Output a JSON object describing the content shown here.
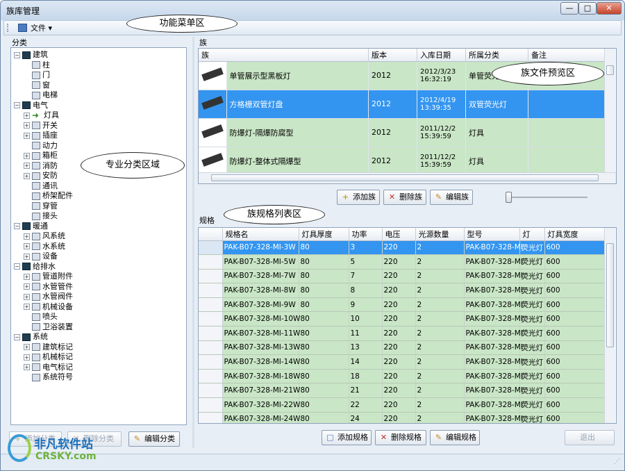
{
  "window": {
    "title": "族库管理",
    "min_icon": "minimize-icon",
    "max_icon": "maximize-icon",
    "close_icon": "close-icon",
    "min_glyph": "—",
    "max_glyph": "□",
    "close_glyph": "✕"
  },
  "menu": {
    "file_label": "文件 ▾"
  },
  "left": {
    "panel_label": "分类"
  },
  "tree": [
    {
      "label": "建筑",
      "level": 0,
      "exp": "−",
      "icon": "dark"
    },
    {
      "label": "柱",
      "level": 1,
      "exp": "",
      "icon": "doc"
    },
    {
      "label": "门",
      "level": 1,
      "exp": "",
      "icon": "doc"
    },
    {
      "label": "窗",
      "level": 1,
      "exp": "",
      "icon": "doc"
    },
    {
      "label": "电梯",
      "level": 1,
      "exp": "",
      "icon": "doc"
    },
    {
      "label": "电气",
      "level": 0,
      "exp": "−",
      "icon": "dark"
    },
    {
      "label": "灯具",
      "level": 1,
      "exp": "+",
      "icon": "arrow"
    },
    {
      "label": "开关",
      "level": 1,
      "exp": "+",
      "icon": "doc"
    },
    {
      "label": "插座",
      "level": 1,
      "exp": "+",
      "icon": "doc"
    },
    {
      "label": "动力",
      "level": 1,
      "exp": "",
      "icon": "doc"
    },
    {
      "label": "箱柜",
      "level": 1,
      "exp": "+",
      "icon": "doc"
    },
    {
      "label": "消防",
      "level": 1,
      "exp": "+",
      "icon": "doc"
    },
    {
      "label": "安防",
      "level": 1,
      "exp": "+",
      "icon": "doc"
    },
    {
      "label": "通讯",
      "level": 1,
      "exp": "",
      "icon": "doc"
    },
    {
      "label": "桥架配件",
      "level": 1,
      "exp": "",
      "icon": "doc"
    },
    {
      "label": "穿管",
      "level": 1,
      "exp": "",
      "icon": "doc"
    },
    {
      "label": "接头",
      "level": 1,
      "exp": "",
      "icon": "doc"
    },
    {
      "label": "暖通",
      "level": 0,
      "exp": "−",
      "icon": "dark"
    },
    {
      "label": "风系统",
      "level": 1,
      "exp": "+",
      "icon": "doc"
    },
    {
      "label": "水系统",
      "level": 1,
      "exp": "+",
      "icon": "doc"
    },
    {
      "label": "设备",
      "level": 1,
      "exp": "+",
      "icon": "doc"
    },
    {
      "label": "给排水",
      "level": 0,
      "exp": "−",
      "icon": "dark"
    },
    {
      "label": "管道附件",
      "level": 1,
      "exp": "+",
      "icon": "doc"
    },
    {
      "label": "水管管件",
      "level": 1,
      "exp": "+",
      "icon": "doc"
    },
    {
      "label": "水管阀件",
      "level": 1,
      "exp": "+",
      "icon": "doc"
    },
    {
      "label": "机械设备",
      "level": 1,
      "exp": "+",
      "icon": "doc"
    },
    {
      "label": "喷头",
      "level": 1,
      "exp": "",
      "icon": "doc"
    },
    {
      "label": "卫浴装置",
      "level": 1,
      "exp": "",
      "icon": "doc"
    },
    {
      "label": "系统",
      "level": 0,
      "exp": "−",
      "icon": "dark"
    },
    {
      "label": "建筑标记",
      "level": 1,
      "exp": "+",
      "icon": "doc"
    },
    {
      "label": "机械标记",
      "level": 1,
      "exp": "+",
      "icon": "doc"
    },
    {
      "label": "电气标记",
      "level": 1,
      "exp": "+",
      "icon": "doc"
    },
    {
      "label": "系统符号",
      "level": 1,
      "exp": "",
      "icon": "doc"
    }
  ],
  "left_buttons": {
    "add": "添加分类",
    "del": "删除分类",
    "edit": "编辑分类"
  },
  "family": {
    "panel_label": "族",
    "headers": [
      "族",
      "版本",
      "入库日期",
      "所属分类",
      "备注"
    ],
    "rows": [
      {
        "name": "单管展示型黑板灯",
        "version": "2012",
        "date": "2012/3/23\n16:32:19",
        "category": "单管荧光灯",
        "note": "",
        "selected": false
      },
      {
        "name": "方格栅双管灯盘",
        "version": "2012",
        "date": "2012/4/19\n13:39:35",
        "category": "双管荧光灯",
        "note": "",
        "selected": true
      },
      {
        "name": "防爆灯-隔爆防腐型",
        "version": "2012",
        "date": "2011/12/2\n15:39:59",
        "category": "灯具",
        "note": "",
        "selected": false
      },
      {
        "name": "防爆灯-整体式隔爆型",
        "version": "2012",
        "date": "2011/12/2\n15:39:59",
        "category": "灯具",
        "note": "",
        "selected": false
      }
    ],
    "buttons": {
      "add": "添加族",
      "del": "删除族",
      "edit": "编辑族"
    }
  },
  "spec": {
    "panel_label": "规格",
    "headers": [
      "规格名",
      "灯具厚度",
      "功率",
      "电压",
      "光源数量",
      "型号",
      "灯",
      "灯具宽度"
    ],
    "rows": [
      [
        "PAK-B07-328-MI-3W",
        "80",
        "3",
        "220",
        "2",
        "PAK-B07-328-MI",
        "荧光灯",
        "600"
      ],
      [
        "PAK-B07-328-MI-5W",
        "80",
        "5",
        "220",
        "2",
        "PAK-B07-328-MI",
        "荧光灯",
        "600"
      ],
      [
        "PAK-B07-328-MI-7W",
        "80",
        "7",
        "220",
        "2",
        "PAK-B07-328-MI",
        "荧光灯",
        "600"
      ],
      [
        "PAK-B07-328-MI-8W",
        "80",
        "8",
        "220",
        "2",
        "PAK-B07-328-MI",
        "荧光灯",
        "600"
      ],
      [
        "PAK-B07-328-MI-9W",
        "80",
        "9",
        "220",
        "2",
        "PAK-B07-328-MI",
        "荧光灯",
        "600"
      ],
      [
        "PAK-B07-328-MI-10W",
        "80",
        "10",
        "220",
        "2",
        "PAK-B07-328-MI",
        "荧光灯",
        "600"
      ],
      [
        "PAK-B07-328-MI-11W",
        "80",
        "11",
        "220",
        "2",
        "PAK-B07-328-MI",
        "荧光灯",
        "600"
      ],
      [
        "PAK-B07-328-MI-13W",
        "80",
        "13",
        "220",
        "2",
        "PAK-B07-328-MI",
        "荧光灯",
        "600"
      ],
      [
        "PAK-B07-328-MI-14W",
        "80",
        "14",
        "220",
        "2",
        "PAK-B07-328-MI",
        "荧光灯",
        "600"
      ],
      [
        "PAK-B07-328-MI-18W",
        "80",
        "18",
        "220",
        "2",
        "PAK-B07-328-MI",
        "荧光灯",
        "600"
      ],
      [
        "PAK-B07-328-MI-21W",
        "80",
        "21",
        "220",
        "2",
        "PAK-B07-328-MI",
        "荧光灯",
        "600"
      ],
      [
        "PAK-B07-328-MI-22W",
        "80",
        "22",
        "220",
        "2",
        "PAK-B07-328-MI",
        "荧光灯",
        "600"
      ],
      [
        "PAK-B07-328-MI-24W",
        "80",
        "24",
        "220",
        "2",
        "PAK-B07-328-MI",
        "荧光灯",
        "600"
      ]
    ],
    "buttons": {
      "add": "添加规格",
      "del": "删除规格",
      "edit": "编辑规格",
      "exit": "退出"
    }
  },
  "callouts": {
    "menu": "功能菜单区",
    "category": "专业分类区域",
    "preview": "族文件预览区",
    "spec": "族规格列表区"
  },
  "watermark": {
    "brand": "非凡软件站",
    "url": "CRSKY.com"
  },
  "colors": {
    "row_green": "#c9e6c6",
    "selected_blue": "#3395f0"
  }
}
